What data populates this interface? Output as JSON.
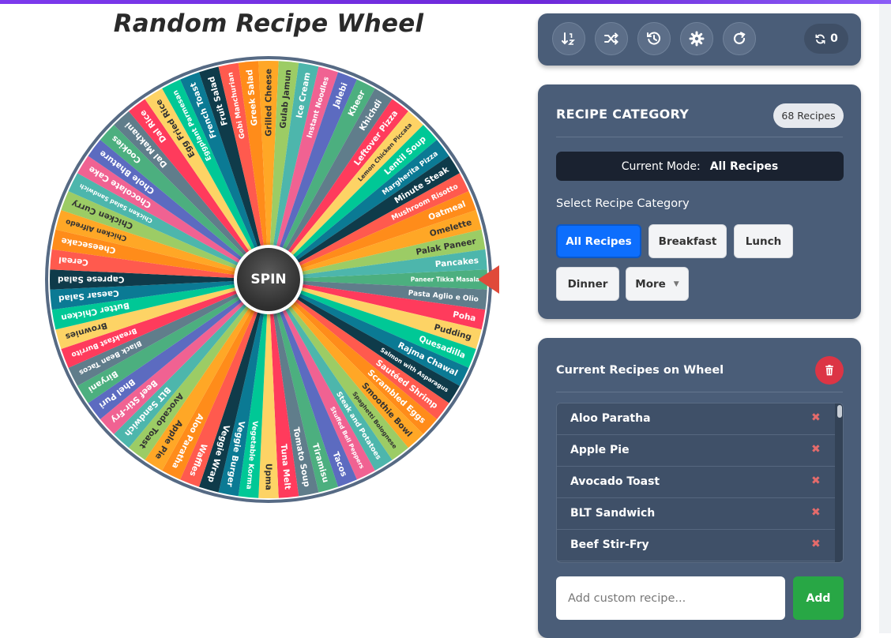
{
  "page": {
    "title": "Random Recipe Wheel"
  },
  "wheel": {
    "spin_label": "SPIN",
    "segments": [
      "Paneer Tikka Masala",
      "Pasta Aglio e Olio",
      "Poha",
      "Pudding",
      "Quesadilla",
      "Rajma Chawal",
      "Salmon with Asparagus",
      "Sautéed Shrimp",
      "Scrambled Eggs",
      "Smoothie Bowl",
      "Spaghetti Bolognese",
      "Steak and Potatoes",
      "Stuffed Bell Peppers",
      "Tacos",
      "Tiramisu",
      "Tomato Soup",
      "Tuna Melt",
      "Upma",
      "Vegetable Korma",
      "Veggie Burger",
      "Veggie Wrap",
      "Waffles",
      "Aloo Paratha",
      "Apple Pie",
      "Avocado Toast",
      "BLT Sandwich",
      "Beef Stir-Fry",
      "Bhel Puri",
      "Biryani",
      "Black Bean Tacos",
      "Breakfast Burrito",
      "Brownies",
      "Butter Chicken",
      "Caesar Salad",
      "Caprese Salad",
      "Cereal",
      "Cheesecake",
      "Chicken Alfredo",
      "Chicken Curry",
      "Chicken Salad Sandwich",
      "Chocolate Cake",
      "Chole Bhature",
      "Cookies",
      "Dal Makhani",
      "Dal Rice",
      "Egg Fried Rice",
      "Eggplant Parmesan",
      "French Toast",
      "Fruit Salad",
      "Gobi Manchurian",
      "Greek Salad",
      "Grilled Cheese",
      "Gulab Jamun",
      "Ice Cream",
      "Instant Noodles",
      "Jalebi",
      "Kheer",
      "Khichdi",
      "Leftover Pizza",
      "Lemon Chicken Piccata",
      "Lentil Soup",
      "Margherita Pizza",
      "Minute Steak",
      "Mushroom Risotto",
      "Oatmeal",
      "Omelette",
      "Palak Paneer",
      "Pancakes"
    ],
    "colors": [
      "#4caf7f",
      "#607d8b",
      "#ff3b5c",
      "#fdd365",
      "#00c896",
      "#0b7a94",
      "#0f3b4a",
      "#ff5a4e",
      "#ff8c1a",
      "#ffa726",
      "#9ccc65",
      "#4db6ac",
      "#f06292",
      "#5c6bc0"
    ]
  },
  "toolbar": {
    "buttons": [
      {
        "icon": "sort-alpha-icon"
      },
      {
        "icon": "shuffle-icon"
      },
      {
        "icon": "history-icon"
      },
      {
        "icon": "gear-icon"
      },
      {
        "icon": "refresh-icon"
      }
    ],
    "spin_count": "0"
  },
  "category": {
    "heading": "RECIPE CATEGORY",
    "count_badge": "68 Recipes",
    "mode_label": "Current Mode:",
    "mode_value": "All Recipes",
    "select_label": "Select Recipe Category",
    "chips": [
      {
        "label": "All Recipes",
        "active": true
      },
      {
        "label": "Breakfast",
        "active": false
      },
      {
        "label": "Lunch",
        "active": false
      },
      {
        "label": "Dinner",
        "active": false
      },
      {
        "label": "More",
        "active": false
      }
    ]
  },
  "current": {
    "heading": "Current Recipes on Wheel",
    "items": [
      "Aloo Paratha",
      "Apple Pie",
      "Avocado Toast",
      "BLT Sandwich",
      "Beef Stir-Fry"
    ],
    "add_placeholder": "Add custom recipe...",
    "add_label": "Add"
  }
}
